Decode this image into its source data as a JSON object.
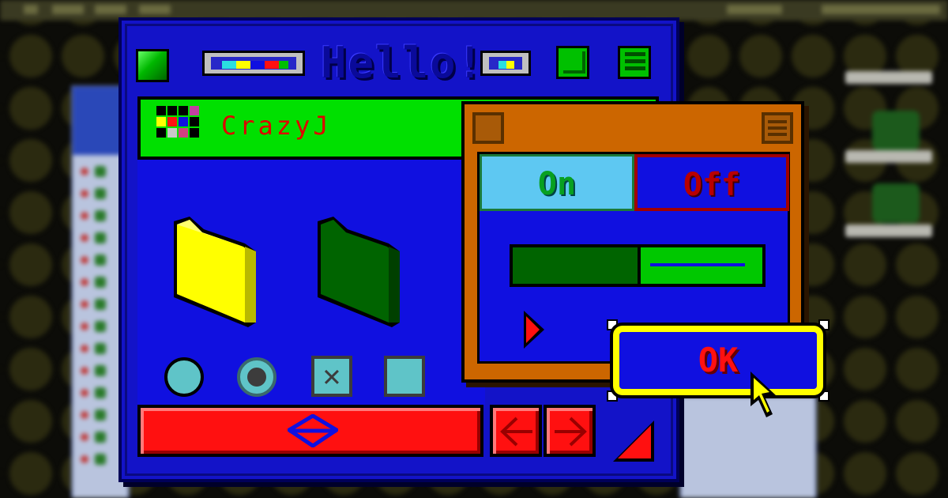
{
  "window": {
    "title": "Hello!"
  },
  "header": {
    "title": "CrazyJ"
  },
  "dialog": {
    "toggle_on_label": "On",
    "toggle_off_label": "Off",
    "slider_value": 0.5
  },
  "ok_button": {
    "label": "OK"
  },
  "colors": {
    "window_bg": "#1313c8",
    "header_bg": "#00e000",
    "accent_red": "#ff1010",
    "dialog_bg": "#cc6600",
    "ok_border": "#ffff00",
    "toggle_on_bg": "#5ec8f2"
  },
  "icons": {
    "folder_yellow": "folder-icon",
    "folder_green": "folder-icon",
    "app_logo": "grid-logo-icon",
    "cursor": "pointer-cursor-icon"
  }
}
